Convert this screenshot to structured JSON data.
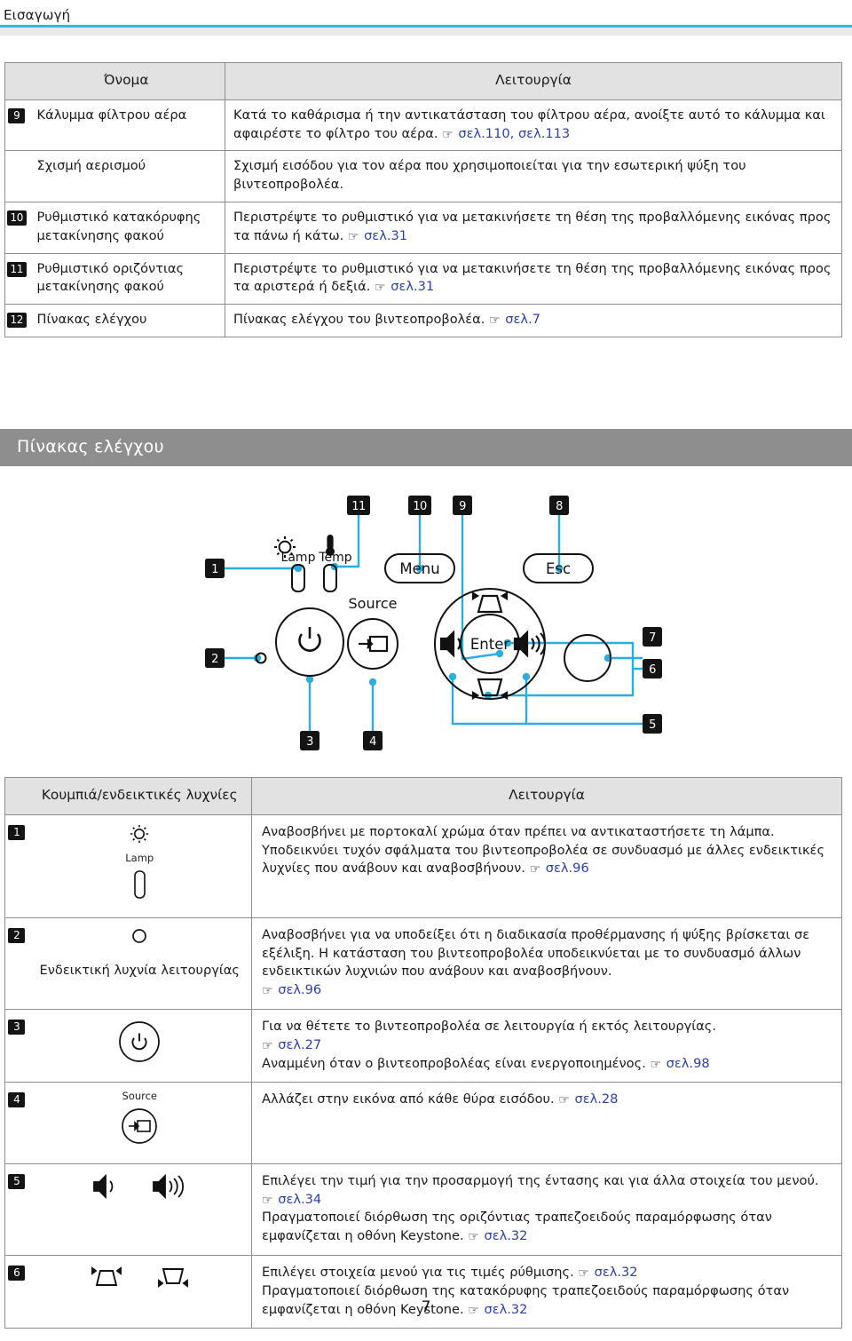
{
  "header": {
    "breadcrumb": "Εισαγωγή"
  },
  "top_table": {
    "headers": {
      "num": "",
      "name": "Όνομα",
      "function": "Λειτουργία"
    },
    "rows": [
      {
        "num": "9",
        "name": "Κάλυμμα φίλτρου αέρα",
        "function_pre": "Κατά το καθάρισμα ή την αντικατάσταση του φίλτρου αέρα, ανοίξτε αυτό το κάλυμμα και αφαιρέστε το φίλτρο του αέρα.",
        "refs": [
          "σελ.110,",
          "σελ.113"
        ]
      },
      {
        "num": "",
        "name": "Σχισμή αερισμού",
        "function_pre": "Σχισμή εισόδου για τον αέρα που χρησιμοποιείται για την εσωτερική ψύξη του βιντεοπροβολέα.",
        "refs": []
      },
      {
        "num": "10",
        "name": "Ρυθμιστικό κατακόρυφης μετακίνησης φακού",
        "function_pre": "Περιστρέψτε το ρυθμιστικό για να μετακινήσετε τη θέση της προβαλλόμενης εικόνας προς τα πάνω ή κάτω.",
        "refs": [
          "σελ.31"
        ]
      },
      {
        "num": "11",
        "name": "Ρυθμιστικό οριζόντιας μετακίνησης φακού",
        "function_pre": "Περιστρέψτε το ρυθμιστικό για να μετακινήσετε τη θέση της προβαλλόμενης εικόνας προς τα αριστερά ή δεξιά.",
        "refs": [
          "σελ.31"
        ]
      },
      {
        "num": "12",
        "name": "Πίνακας ελέγχου",
        "function_pre": "Πίνακας ελέγχου του βιντεοπροβολέα.",
        "refs": [
          "σελ.7"
        ]
      }
    ]
  },
  "section": {
    "title": "Πίνακας ελέγχου"
  },
  "diagram": {
    "callouts": [
      "1",
      "2",
      "3",
      "4",
      "5",
      "6",
      "7",
      "8",
      "9",
      "10",
      "11"
    ],
    "labels": {
      "lamp": "Lamp",
      "temp": "Temp",
      "menu": "Menu",
      "esc": "Esc",
      "source": "Source",
      "enter": "Enter"
    }
  },
  "bottom_table": {
    "headers": {
      "num": "",
      "buttons": "Κουμπιά/ενδεικτικές λυχνίες",
      "function": "Λειτουργία"
    },
    "rows": [
      {
        "num": "1",
        "icon_name": "lamp-indicator-icon",
        "icon_caption": "Lamp",
        "lines": [
          {
            "text": "Αναβοσβήνει με πορτοκαλί χρώμα όταν πρέπει να αντικαταστήσετε τη λάμπα. Υποδεικνύει τυχόν σφάλματα του βιντεοπροβολέα σε συνδυασμό με άλλες ενδεικτικές λυχνίες που ανάβουν και αναβοσβήνουν.",
            "ref": "σελ.96"
          }
        ]
      },
      {
        "num": "2",
        "icon_name": "power-indicator-icon",
        "icon_caption": "Ενδεικτική λυχνία λειτουργίας",
        "lines": [
          {
            "text": "Αναβοσβήνει για να υποδείξει ότι η διαδικασία προθέρμανσης ή ψύξης βρίσκεται σε εξέλιξη. Η κατάσταση του βιντεοπροβολέα υποδεικνύεται με το συνδυασμό άλλων ενδεικτικών λυχνιών που ανάβουν και αναβοσβήνουν.",
            "ref": "σελ.96"
          }
        ]
      },
      {
        "num": "3",
        "icon_name": "power-button-icon",
        "icon_caption": "",
        "lines": [
          {
            "text": "Για να θέτετε το βιντεοπροβολέα σε λειτουργία ή εκτός λειτουργίας.",
            "ref": "σελ.27"
          },
          {
            "text": "Αναμμένη όταν ο βιντεοπροβολέας είναι ενεργοποιημένος.",
            "ref": "σελ.98"
          }
        ]
      },
      {
        "num": "4",
        "icon_name": "source-button-icon",
        "icon_caption": "Source",
        "lines": [
          {
            "text": "Αλλάζει στην εικόνα από κάθε θύρα εισόδου.",
            "ref": "σελ.28"
          }
        ]
      },
      {
        "num": "5",
        "icon_name": "volume-buttons-icon",
        "icon_caption": "",
        "lines": [
          {
            "text": "Επιλέγει την τιμή για την προσαρμογή της έντασης και για άλλα στοιχεία του μενού.",
            "ref": "σελ.34"
          },
          {
            "text": "Πραγματοποιεί διόρθωση της οριζόντιας τραπεζοειδούς παραμόρφωσης όταν εμφανίζεται η οθόνη Keystone.",
            "ref": "σελ.32"
          }
        ]
      },
      {
        "num": "6",
        "icon_name": "keystone-buttons-icon",
        "icon_caption": "",
        "lines": [
          {
            "text": "Επιλέγει στοιχεία μενού για τις τιμές ρύθμισης.",
            "ref": "σελ.32"
          },
          {
            "text": "Πραγματοποιεί διόρθωση της κατακόρυφης τραπεζοειδούς παραμόρφωσης όταν εμφανίζεται η οθόνη Keystone.",
            "ref": "σελ.32"
          }
        ]
      }
    ]
  },
  "footer": {
    "page_number": "7"
  },
  "colors": {
    "accent_cyan": "#33b5e6",
    "section_gray": "#8e8e8e",
    "header_row_gray": "#e2e2e2",
    "link_blue": "#2a3fb0",
    "badge_black": "#141414"
  }
}
